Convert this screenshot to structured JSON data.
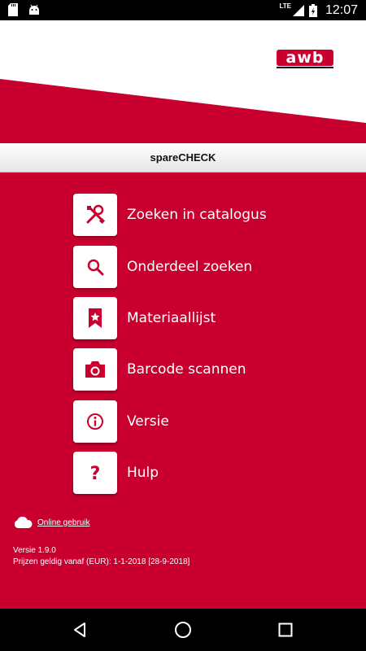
{
  "status_bar": {
    "time": "12:07",
    "network": "LTE"
  },
  "app": {
    "title": "spareCHECK",
    "logo_text": "awb"
  },
  "menu": [
    {
      "label": "Zoeken in catalogus",
      "icon": "tools-icon"
    },
    {
      "label": "Onderdeel zoeken",
      "icon": "search-icon"
    },
    {
      "label": "Materiaallijst",
      "icon": "bookmark-star-icon"
    },
    {
      "label": "Barcode scannen",
      "icon": "camera-icon"
    },
    {
      "label": "Versie",
      "icon": "info-icon"
    },
    {
      "label": "Hulp",
      "icon": "question-icon"
    }
  ],
  "footer": {
    "online_label": "Online gebruik",
    "version": "Versie 1.9.0",
    "prices": "Prijzen geldig vanaf (EUR): 1-1-2018 [28-9-2018]"
  },
  "colors": {
    "brand": "#c9002f",
    "header_bg": "#ffffff"
  }
}
